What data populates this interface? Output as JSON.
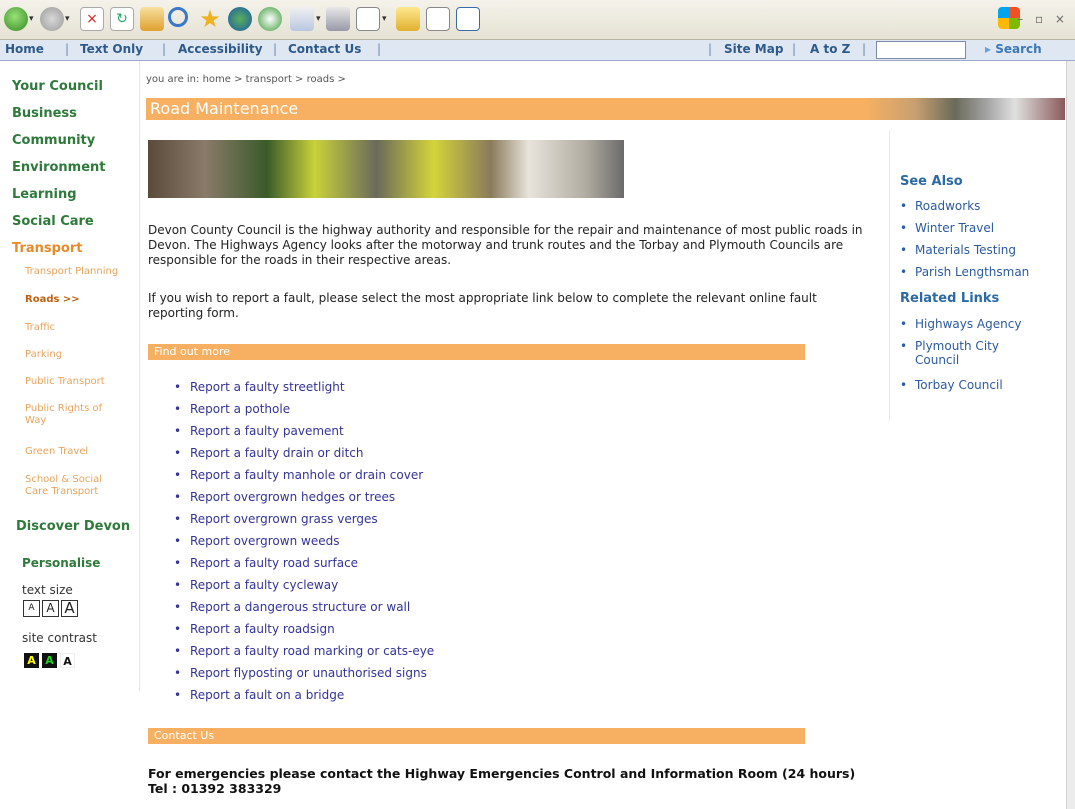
{
  "topnav": {
    "items": [
      "Home",
      "Text Only",
      "Accessibility",
      "Contact Us"
    ],
    "right_items": [
      "Site Map",
      "A to Z"
    ],
    "search_label": "Search"
  },
  "left_nav": {
    "main": [
      "Your Council",
      "Business",
      "Community",
      "Environment",
      "Learning",
      "Social Care"
    ],
    "transport": "Transport",
    "sub": [
      "Transport Planning",
      "Roads >>",
      "Traffic",
      "Parking",
      "Public Transport",
      "Public Rights of Way",
      "Green Travel",
      "School & Social Care Transport"
    ],
    "discover": "Discover Devon",
    "personalise": "Personalise",
    "text_size_label": "text size",
    "text_size_opts": [
      "A",
      "A",
      "A"
    ],
    "contrast_label": "site contrast",
    "contrast_opts": [
      "A",
      "A",
      "A"
    ]
  },
  "breadcrumb": "you are in: home > transport > roads >",
  "page_title": "Road Maintenance",
  "intro": "Devon County Council is the highway authority and responsible for the repair and maintenance of most public roads in Devon. The Highways Agency looks after the motorway and trunk routes and the Torbay and Plymouth Councils are responsible for the roads in their respective areas.",
  "report_intro": "If you wish to report a fault, please select the most appropriate link below to complete the relevant online fault reporting form.",
  "find_out_more": "Find out more",
  "report_links": [
    "Report a faulty streetlight",
    "Report a pothole",
    "Report a faulty pavement",
    "Report a faulty drain or ditch",
    "Report a faulty manhole or drain cover",
    "Report overgrown hedges or trees",
    "Report overgrown grass verges",
    "Report overgrown weeds",
    "Report a faulty road surface",
    "Report a faulty cycleway",
    "Report a dangerous structure or wall",
    "Report a faulty roadsign",
    "Report a faulty road marking or cats-eye",
    "Report flyposting or unauthorised signs",
    "Report a fault on a bridge"
  ],
  "contact_us": "Contact Us",
  "emergency": "For emergencies please contact the Highway Emergencies Control and Information Room (24 hours) Tel : 01392 383329",
  "see_also": {
    "heading": "See Also",
    "items": [
      "Roadworks",
      "Winter Travel",
      "Materials Testing",
      "Parish Lengthsman"
    ]
  },
  "related_links": {
    "heading": "Related Links",
    "items": [
      "Highways Agency",
      "Plymouth City Council",
      "Torbay Council"
    ]
  },
  "colors": {
    "accent_orange": "#f7b061",
    "nav_green": "#2e7a3a",
    "link_blue": "#333399"
  }
}
